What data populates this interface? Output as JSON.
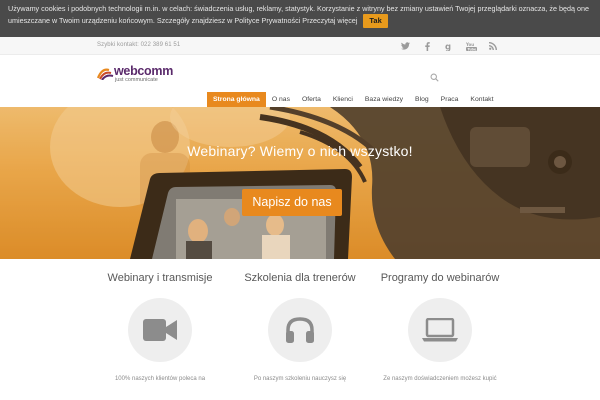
{
  "cookie_bar": {
    "message": "Używamy cookies i podobnych technologii m.in. w celach: świadczenia usług, reklamy, statystyk. Korzystanie z witryny bez zmiany ustawień Twojej przeglądarki oznacza, że będą one umieszczane w Twoim urządzeniu końcowym. Szczegóły znajdziesz w Polityce Prywatności Przeczytaj więcej",
    "accept_label": "Tak"
  },
  "top_strip": {
    "contact": "Szybki kontakt: 022 389 61 51",
    "social_icons": [
      "twitter-icon",
      "facebook-icon",
      "google-plus-icon",
      "youtube-icon",
      "rss-icon"
    ]
  },
  "header": {
    "logo_text": "webcomm",
    "logo_tagline": "just communicate"
  },
  "nav": {
    "items": [
      "Strona główna",
      "O nas",
      "Oferta",
      "Klienci",
      "Baza wiedzy",
      "Blog",
      "Praca",
      "Kontakt"
    ],
    "active_index": 0
  },
  "hero": {
    "title": "Webinary? Wiemy o nich wszystko!",
    "cta_label": "Napisz do nas"
  },
  "services": [
    {
      "title": "Webinary i transmisje",
      "icon": "video-camera-icon",
      "text": "100% naszych klientów poleca na"
    },
    {
      "title": "Szkolenia dla trenerów",
      "icon": "headphones-icon",
      "text": "Po naszym szkoleniu nauczysz się"
    },
    {
      "title": "Programy do webinarów",
      "icon": "laptop-icon",
      "text": "Ze naszym doświadczeniem możesz kupić"
    }
  ],
  "colors": {
    "accent": "#e8891e",
    "cookie_bar_bg": "#4a4a4a",
    "logo_purple": "#5a2a6b"
  }
}
